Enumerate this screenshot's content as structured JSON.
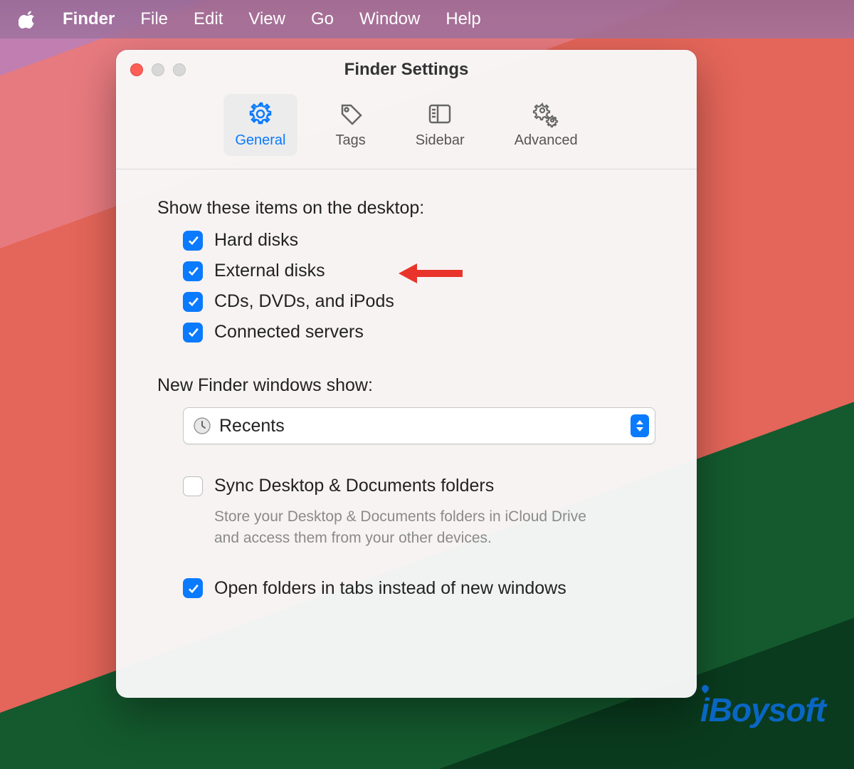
{
  "menubar": {
    "app": "Finder",
    "items": [
      "File",
      "Edit",
      "View",
      "Go",
      "Window",
      "Help"
    ]
  },
  "window": {
    "title": "Finder Settings"
  },
  "toolbar": {
    "tabs": [
      {
        "label": "General",
        "icon": "gear-icon",
        "active": true
      },
      {
        "label": "Tags",
        "icon": "tag-icon",
        "active": false
      },
      {
        "label": "Sidebar",
        "icon": "sidebar-icon",
        "active": false
      },
      {
        "label": "Advanced",
        "icon": "gears-icon",
        "active": false
      }
    ]
  },
  "sections": {
    "show_desktop": {
      "title": "Show these items on the desktop:",
      "items": [
        {
          "label": "Hard disks",
          "checked": true
        },
        {
          "label": "External disks",
          "checked": true
        },
        {
          "label": "CDs, DVDs, and iPods",
          "checked": true
        },
        {
          "label": "Connected servers",
          "checked": true
        }
      ]
    },
    "new_windows": {
      "title": "New Finder windows show:",
      "value": "Recents"
    },
    "sync": {
      "label": "Sync Desktop & Documents folders",
      "checked": false,
      "description": "Store your Desktop & Documents folders in iCloud Drive and access them from your other devices."
    },
    "open_tabs": {
      "label": "Open folders in tabs instead of new windows",
      "checked": true
    }
  },
  "annotation": {
    "arrow_target": "External disks"
  },
  "watermark": "iBoysoft"
}
